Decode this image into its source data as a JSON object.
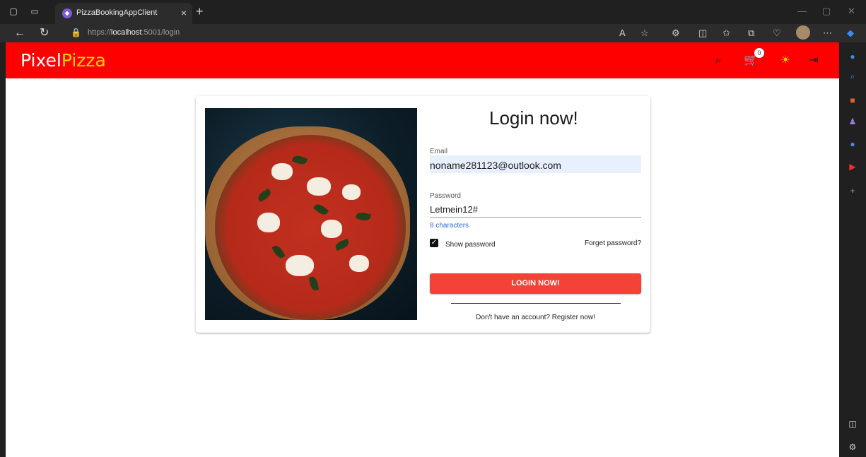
{
  "browser": {
    "tab_title": "PizzaBookingAppClient",
    "url_prefix": "https://",
    "url_host": "localhost",
    "url_rest": ":5001/login"
  },
  "app": {
    "brand_part1": "Pixel",
    "brand_part2": "Pizza",
    "cart_count": "0",
    "accent_color": "#ff0000",
    "brand_secondary_color": "#ffd400"
  },
  "login": {
    "title": "Login now!",
    "email_label": "Email",
    "email_value": "noname281123@outlook.com",
    "password_label": "Password",
    "password_value": "Letmein12#",
    "password_hint": "8 characters",
    "show_password_label": "Show password",
    "show_password_checked": true,
    "forgot_label": "Forget password?",
    "login_button": "LOGIN NOW!",
    "register_text": "Don't have an account? Register now!",
    "button_color": "#f44336"
  }
}
